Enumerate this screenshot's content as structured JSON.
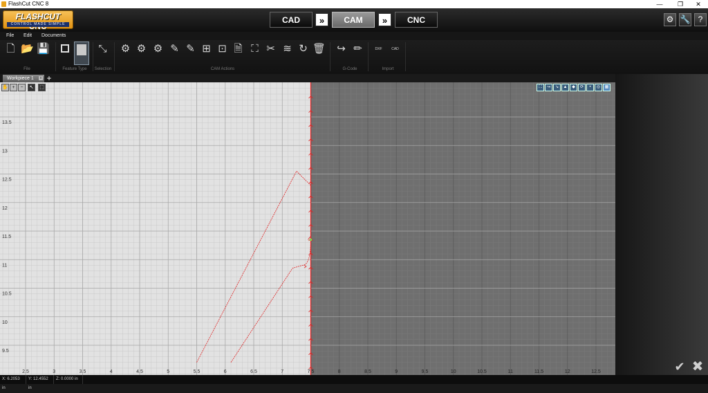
{
  "window": {
    "title": "FlashCut CNC 8",
    "controls": {
      "minimize": "—",
      "restore": "❐",
      "close": "✕"
    }
  },
  "logo": {
    "main": "FLASHCUT CNC",
    "tagline": "CONTROL MADE SIMPLE"
  },
  "modes": {
    "cad": "CAD",
    "cam": "CAM",
    "cnc": "CNC",
    "active": "CAM",
    "arrow": "»"
  },
  "header_icons": {
    "settings": "⚙",
    "tools": "🔧",
    "help": "?"
  },
  "menu": [
    "File",
    "Edit",
    "Documents"
  ],
  "ribbon": {
    "groups": {
      "file": "File",
      "feature_type": "Feature Type",
      "selection": "Selection",
      "cam_actions": "CAM Actions",
      "gcode": "G-Code",
      "import": "Import"
    },
    "import_labels": {
      "dxf": "DXF",
      "cad": "CAD"
    }
  },
  "tabs": {
    "active": "Workpiece 1",
    "close": "x",
    "add": "+"
  },
  "canvas": {
    "x_ticks": [
      "2.5",
      "3",
      "3.5",
      "4",
      "4.5",
      "5",
      "5.5",
      "6",
      "6.5",
      "7",
      "7.5",
      "8",
      "8.5",
      "9",
      "9.5",
      "10",
      "10.5",
      "11",
      "11.5",
      "12",
      "12.5"
    ],
    "y_ticks": [
      "13.5",
      "13",
      "12.5",
      "12",
      "11.5",
      "11",
      "10.5",
      "10",
      "9.5"
    ],
    "workpiece_boundary_x": 7.5,
    "toolpaths": {
      "upper_lead": [
        [
          5.5,
          9.2
        ],
        [
          7.25,
          12.55
        ],
        [
          7.5,
          12.3
        ]
      ],
      "lower_lead": [
        [
          6.1,
          9.2
        ],
        [
          7.18,
          10.85
        ],
        [
          7.35,
          10.9
        ],
        [
          7.5,
          11.35
        ]
      ]
    },
    "colors": {
      "grid_background": "#e2e2e2",
      "offstock_background": "#6f6f6f",
      "toolpath": "#e02020",
      "minor_grid": "#c9c9c9",
      "major_grid": "#a8a8a8"
    }
  },
  "status": {
    "x": "X: 6.2053 in",
    "y": "Y: 12.4552 in",
    "z": "Z: 0.0000 in"
  },
  "actions": {
    "ok": "✔",
    "cancel": "✖"
  }
}
